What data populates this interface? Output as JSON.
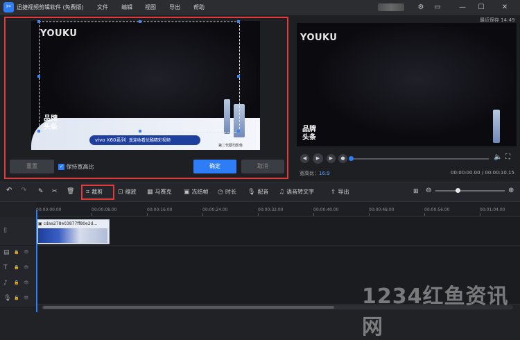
{
  "app": {
    "title": "迅捷视频剪辑软件 (免费版)",
    "logo": "app-logo-icon"
  },
  "menu": [
    {
      "label": "文件"
    },
    {
      "label": "编辑"
    },
    {
      "label": "视图"
    },
    {
      "label": "导出"
    },
    {
      "label": "帮助"
    }
  ],
  "window": {
    "min": "—",
    "max": "☐",
    "close": "✕",
    "settings": "⚙",
    "minimize_sym": "▭"
  },
  "preview_header": {
    "autosave": "最近保存 14:49"
  },
  "video": {
    "logo": "YOUKU",
    "brand_line1": "品牌",
    "brand_line2": "头条",
    "banner_text": "vivo X60系列",
    "banner_sub": "遥迎收看优酷精彩视频",
    "tag": "第二代蔡司影像"
  },
  "crop_controls": {
    "reset": "重置",
    "keep_ratio": "保持宽高比",
    "keep_ratio_checked": true,
    "confirm": "确定",
    "cancel": "取消"
  },
  "player": {
    "aspect_label": "宽高比：",
    "aspect_value": "16:9",
    "time": "00:00:00.00 / 00:00:10.15",
    "progress": 0.0
  },
  "toolbar": {
    "undo": "↶",
    "redo": "↷",
    "crop": "裁剪",
    "zoom": "缩放",
    "mosaic": "马赛克",
    "freeze": "冻结帧",
    "duration": "时长",
    "dub": "配音",
    "speech_to_text": "语音转文字",
    "export": "导出",
    "zoom_level": 0.29
  },
  "ruler": [
    "00:00:00.00",
    "00:00:08.00",
    "00:00:16.00",
    "00:00:24.00",
    "00:00:32.00",
    "00:00:40.00",
    "00:00:48.00",
    "00:00:56.00",
    "00:01:04.00"
  ],
  "clip": {
    "name": "cdaa278e03877ff80e2d..."
  },
  "tracks": [
    {
      "icon": "▯"
    },
    {
      "icon": "▤"
    },
    {
      "icon": "T"
    },
    {
      "icon": "♪"
    },
    {
      "icon": "🎙"
    }
  ],
  "watermark": "1234红鱼资讯网"
}
